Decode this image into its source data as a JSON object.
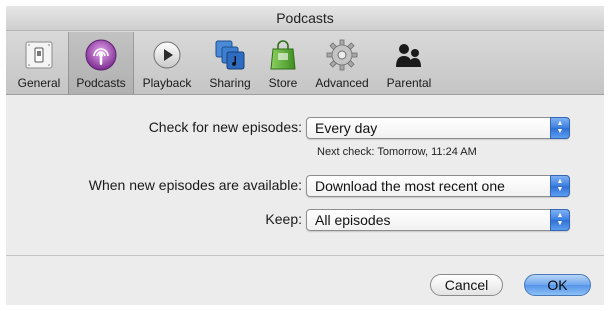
{
  "window": {
    "title": "Podcasts"
  },
  "toolbar": {
    "items": [
      {
        "label": "General",
        "icon": "switch-icon",
        "selected": false
      },
      {
        "label": "Podcasts",
        "icon": "podcast-icon",
        "selected": true
      },
      {
        "label": "Playback",
        "icon": "play-icon",
        "selected": false
      },
      {
        "label": "Sharing",
        "icon": "sharing-icon",
        "selected": false
      },
      {
        "label": "Store",
        "icon": "shopping-bag-icon",
        "selected": false
      },
      {
        "label": "Advanced",
        "icon": "gear-icon",
        "selected": false
      },
      {
        "label": "Parental",
        "icon": "parental-icon",
        "selected": false
      }
    ]
  },
  "settings": {
    "check_label": "Check for new episodes:",
    "check_value": "Every day",
    "next_check": "Next check: Tomorrow, 11:24 AM",
    "when_label": "When new episodes are available:",
    "when_value": "Download the most recent one",
    "keep_label": "Keep:",
    "keep_value": "All episodes"
  },
  "buttons": {
    "cancel": "Cancel",
    "ok": "OK"
  },
  "colors": {
    "accent": "#3b7ee0",
    "podcast_purple": "#8e3fa3",
    "store_green": "#5aa832"
  }
}
